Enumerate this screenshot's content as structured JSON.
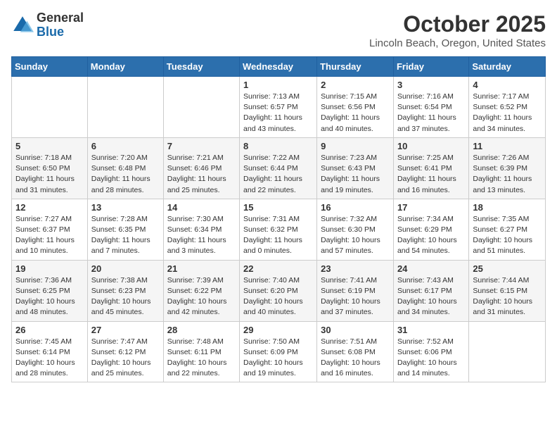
{
  "logo": {
    "general": "General",
    "blue": "Blue"
  },
  "title": "October 2025",
  "location": "Lincoln Beach, Oregon, United States",
  "days_of_week": [
    "Sunday",
    "Monday",
    "Tuesday",
    "Wednesday",
    "Thursday",
    "Friday",
    "Saturday"
  ],
  "weeks": [
    [
      {
        "day": "",
        "info": ""
      },
      {
        "day": "",
        "info": ""
      },
      {
        "day": "",
        "info": ""
      },
      {
        "day": "1",
        "info": "Sunrise: 7:13 AM\nSunset: 6:57 PM\nDaylight: 11 hours\nand 43 minutes."
      },
      {
        "day": "2",
        "info": "Sunrise: 7:15 AM\nSunset: 6:56 PM\nDaylight: 11 hours\nand 40 minutes."
      },
      {
        "day": "3",
        "info": "Sunrise: 7:16 AM\nSunset: 6:54 PM\nDaylight: 11 hours\nand 37 minutes."
      },
      {
        "day": "4",
        "info": "Sunrise: 7:17 AM\nSunset: 6:52 PM\nDaylight: 11 hours\nand 34 minutes."
      }
    ],
    [
      {
        "day": "5",
        "info": "Sunrise: 7:18 AM\nSunset: 6:50 PM\nDaylight: 11 hours\nand 31 minutes."
      },
      {
        "day": "6",
        "info": "Sunrise: 7:20 AM\nSunset: 6:48 PM\nDaylight: 11 hours\nand 28 minutes."
      },
      {
        "day": "7",
        "info": "Sunrise: 7:21 AM\nSunset: 6:46 PM\nDaylight: 11 hours\nand 25 minutes."
      },
      {
        "day": "8",
        "info": "Sunrise: 7:22 AM\nSunset: 6:44 PM\nDaylight: 11 hours\nand 22 minutes."
      },
      {
        "day": "9",
        "info": "Sunrise: 7:23 AM\nSunset: 6:43 PM\nDaylight: 11 hours\nand 19 minutes."
      },
      {
        "day": "10",
        "info": "Sunrise: 7:25 AM\nSunset: 6:41 PM\nDaylight: 11 hours\nand 16 minutes."
      },
      {
        "day": "11",
        "info": "Sunrise: 7:26 AM\nSunset: 6:39 PM\nDaylight: 11 hours\nand 13 minutes."
      }
    ],
    [
      {
        "day": "12",
        "info": "Sunrise: 7:27 AM\nSunset: 6:37 PM\nDaylight: 11 hours\nand 10 minutes."
      },
      {
        "day": "13",
        "info": "Sunrise: 7:28 AM\nSunset: 6:35 PM\nDaylight: 11 hours\nand 7 minutes."
      },
      {
        "day": "14",
        "info": "Sunrise: 7:30 AM\nSunset: 6:34 PM\nDaylight: 11 hours\nand 3 minutes."
      },
      {
        "day": "15",
        "info": "Sunrise: 7:31 AM\nSunset: 6:32 PM\nDaylight: 11 hours\nand 0 minutes."
      },
      {
        "day": "16",
        "info": "Sunrise: 7:32 AM\nSunset: 6:30 PM\nDaylight: 10 hours\nand 57 minutes."
      },
      {
        "day": "17",
        "info": "Sunrise: 7:34 AM\nSunset: 6:29 PM\nDaylight: 10 hours\nand 54 minutes."
      },
      {
        "day": "18",
        "info": "Sunrise: 7:35 AM\nSunset: 6:27 PM\nDaylight: 10 hours\nand 51 minutes."
      }
    ],
    [
      {
        "day": "19",
        "info": "Sunrise: 7:36 AM\nSunset: 6:25 PM\nDaylight: 10 hours\nand 48 minutes."
      },
      {
        "day": "20",
        "info": "Sunrise: 7:38 AM\nSunset: 6:23 PM\nDaylight: 10 hours\nand 45 minutes."
      },
      {
        "day": "21",
        "info": "Sunrise: 7:39 AM\nSunset: 6:22 PM\nDaylight: 10 hours\nand 42 minutes."
      },
      {
        "day": "22",
        "info": "Sunrise: 7:40 AM\nSunset: 6:20 PM\nDaylight: 10 hours\nand 40 minutes."
      },
      {
        "day": "23",
        "info": "Sunrise: 7:41 AM\nSunset: 6:19 PM\nDaylight: 10 hours\nand 37 minutes."
      },
      {
        "day": "24",
        "info": "Sunrise: 7:43 AM\nSunset: 6:17 PM\nDaylight: 10 hours\nand 34 minutes."
      },
      {
        "day": "25",
        "info": "Sunrise: 7:44 AM\nSunset: 6:15 PM\nDaylight: 10 hours\nand 31 minutes."
      }
    ],
    [
      {
        "day": "26",
        "info": "Sunrise: 7:45 AM\nSunset: 6:14 PM\nDaylight: 10 hours\nand 28 minutes."
      },
      {
        "day": "27",
        "info": "Sunrise: 7:47 AM\nSunset: 6:12 PM\nDaylight: 10 hours\nand 25 minutes."
      },
      {
        "day": "28",
        "info": "Sunrise: 7:48 AM\nSunset: 6:11 PM\nDaylight: 10 hours\nand 22 minutes."
      },
      {
        "day": "29",
        "info": "Sunrise: 7:50 AM\nSunset: 6:09 PM\nDaylight: 10 hours\nand 19 minutes."
      },
      {
        "day": "30",
        "info": "Sunrise: 7:51 AM\nSunset: 6:08 PM\nDaylight: 10 hours\nand 16 minutes."
      },
      {
        "day": "31",
        "info": "Sunrise: 7:52 AM\nSunset: 6:06 PM\nDaylight: 10 hours\nand 14 minutes."
      },
      {
        "day": "",
        "info": ""
      }
    ]
  ]
}
